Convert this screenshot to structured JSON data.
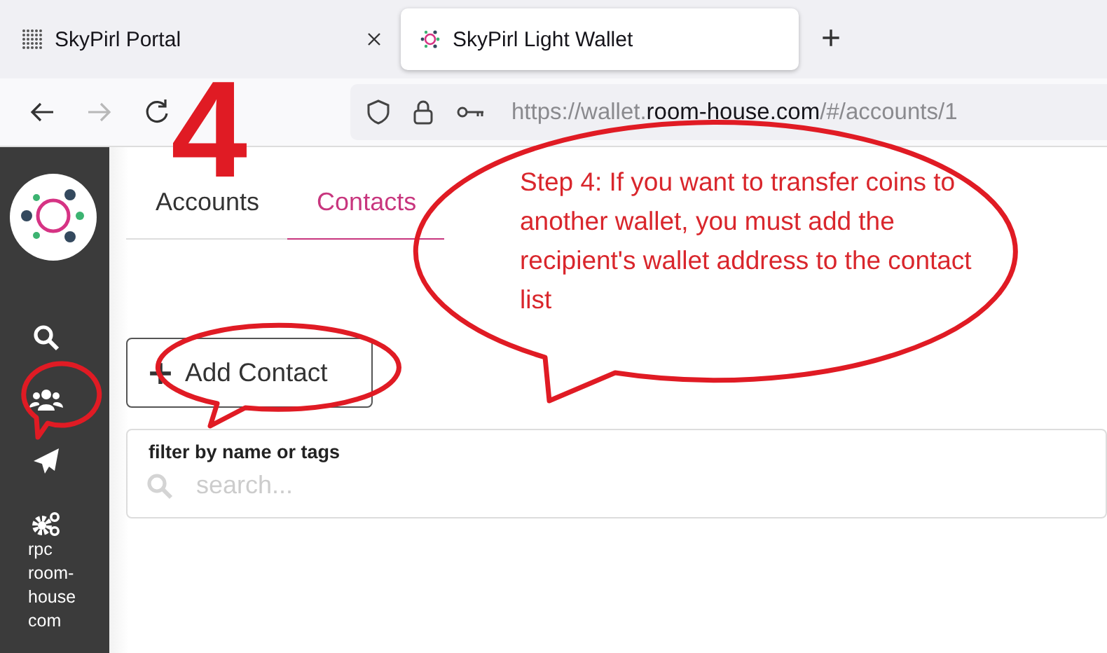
{
  "browser": {
    "tabs": [
      {
        "title": "SkyPirl Portal",
        "selected": false,
        "closable": true
      },
      {
        "title": "SkyPirl Light Wallet",
        "selected": true,
        "closable": false
      }
    ],
    "new_tab": "+",
    "forward_disabled": true,
    "url": {
      "scheme": "https://wallet.",
      "domain": "room-house.com",
      "path": "/#/accounts/1"
    }
  },
  "sidebar": {
    "items": [
      {
        "kind": "search"
      },
      {
        "kind": "contacts"
      },
      {
        "kind": "send"
      },
      {
        "kind": "settings"
      }
    ],
    "server_label": "rpc room-house com"
  },
  "tabs": [
    {
      "label": "Accounts",
      "selected": false
    },
    {
      "label": "Contacts",
      "selected": true
    }
  ],
  "add_button": {
    "label": "Add Contact"
  },
  "filter": {
    "label": "filter by name or tags",
    "placeholder": "search..."
  },
  "annotation": {
    "step": "4",
    "callout": "Step 4: If you want to transfer coins to another wallet, you must add the recipient's wallet address to the contact list"
  }
}
